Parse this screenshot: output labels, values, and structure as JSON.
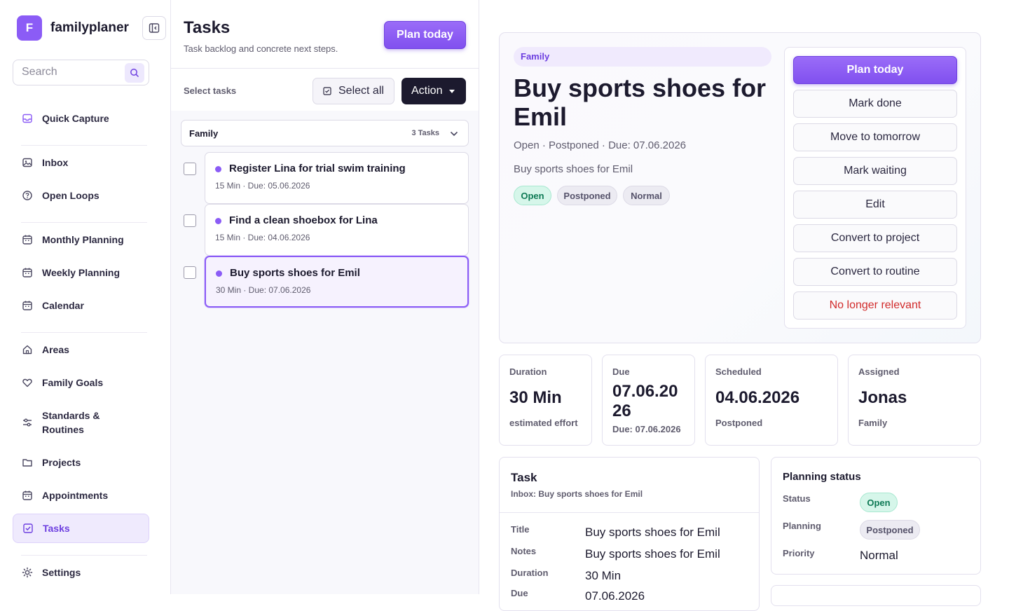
{
  "app": {
    "name": "familyplaner",
    "logo_letter": "F"
  },
  "search": {
    "placeholder": "Search"
  },
  "sidebar": {
    "items": [
      {
        "label": "Quick Capture",
        "icon": "inbox-tray-icon"
      },
      {
        "label": "Inbox",
        "icon": "image-icon"
      },
      {
        "label": "Open Loops",
        "icon": "question-circle-icon"
      },
      {
        "label": "Monthly Planning",
        "icon": "calendar-icon"
      },
      {
        "label": "Weekly Planning",
        "icon": "calendar-icon"
      },
      {
        "label": "Calendar",
        "icon": "calendar-icon"
      },
      {
        "label": "Areas",
        "icon": "home-icon"
      },
      {
        "label": "Family Goals",
        "icon": "heart-icon"
      },
      {
        "label": "Standards & Routines",
        "icon": "sliders-icon"
      },
      {
        "label": "Projects",
        "icon": "folder-icon"
      },
      {
        "label": "Appointments",
        "icon": "calendar-icon"
      },
      {
        "label": "Tasks",
        "icon": "check-square-icon",
        "active": true
      },
      {
        "label": "Settings",
        "icon": "gear-icon"
      }
    ]
  },
  "tasks_panel": {
    "title": "Tasks",
    "subtitle": "Task backlog and concrete next steps.",
    "plan_today": "Plan today",
    "select_tasks": "Select tasks",
    "select_all": "Select all",
    "action": "Action",
    "group": {
      "name": "Family",
      "count": "3 Tasks"
    },
    "tasks": [
      {
        "title": "Register Lina for trial swim training",
        "meta": "15 Min · Due: 05.06.2026"
      },
      {
        "title": "Find a clean shoebox for Lina",
        "meta": "15 Min · Due: 04.06.2026"
      },
      {
        "title": "Buy sports shoes for Emil",
        "meta": "30 Min · Due: 07.06.2026",
        "selected": true
      }
    ]
  },
  "detail": {
    "area_tag": "Family",
    "title": "Buy sports shoes for Emil",
    "meta": "Open · Postponed · Due: 07.06.2026",
    "description": "Buy sports shoes for Emil",
    "pills": [
      "Open",
      "Postponed",
      "Normal"
    ],
    "actions": {
      "plan_today": "Plan today",
      "mark_done": "Mark done",
      "move_tomorrow": "Move to tomorrow",
      "mark_waiting": "Mark waiting",
      "edit": "Edit",
      "convert_project": "Convert to project",
      "convert_routine": "Convert to routine",
      "no_longer_relevant": "No longer relevant"
    },
    "stats": [
      {
        "label": "Duration",
        "value": "30 Min",
        "sub": "estimated effort"
      },
      {
        "label": "Due",
        "value": "07.06.20\n26",
        "sub": "Due: 07.06.2026"
      },
      {
        "label": "Scheduled",
        "value": "04.06.2026",
        "sub": "Postponed"
      },
      {
        "label": "Assigned",
        "value": "Jonas",
        "sub": "Family"
      }
    ],
    "task_section": {
      "heading": "Task",
      "subheading": "Inbox: Buy sports shoes for Emil",
      "fields": [
        {
          "key": "Title",
          "value": "Buy sports shoes for Emil"
        },
        {
          "key": "Notes",
          "value": "Buy sports shoes for Emil"
        },
        {
          "key": "Duration",
          "value": "30 Min"
        },
        {
          "key": "Due",
          "value": "07.06.2026"
        }
      ]
    },
    "planning_status": {
      "heading": "Planning status",
      "status_label": "Status",
      "status_value": "Open",
      "planning_label": "Planning",
      "planning_value": "Postponed",
      "priority_label": "Priority",
      "priority_value": "Normal"
    }
  },
  "colors": {
    "accent": "#8b5cf6",
    "danger": "#d12b2b",
    "success": "#0e7a55",
    "dark": "#1c1a2e"
  }
}
